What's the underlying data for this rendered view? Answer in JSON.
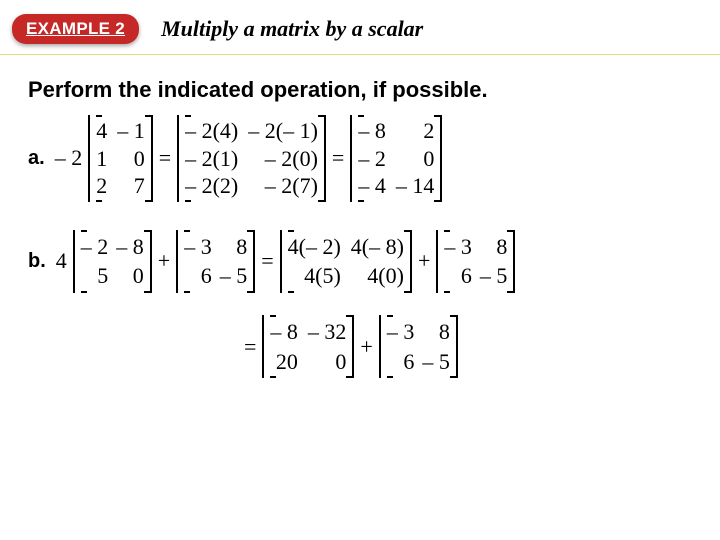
{
  "header": {
    "badge": "EXAMPLE 2",
    "title": "Multiply a matrix by a scalar"
  },
  "instruction": "Perform the indicated operation, if possible.",
  "partA": {
    "label": "a.",
    "scalar": "– 2",
    "m1": {
      "c1": [
        "4",
        "1",
        "2"
      ],
      "c2": [
        "– 1",
        "0",
        "7"
      ]
    },
    "eq1": "=",
    "m2": {
      "c1": [
        "– 2(4)",
        "– 2(1)",
        "– 2(2)"
      ],
      "c2": [
        "– 2(– 1)",
        "– 2(0)",
        "– 2(7)"
      ]
    },
    "eq2": "=",
    "m3": {
      "c1": [
        "– 8",
        "– 2",
        "– 4"
      ],
      "c2": [
        "2",
        "0",
        "– 14"
      ]
    }
  },
  "partB": {
    "label": "b.",
    "scalar": "4",
    "m1": {
      "c1": [
        "– 2",
        "5"
      ],
      "c2": [
        "– 8",
        "0"
      ]
    },
    "plus1": "+",
    "m2": {
      "c1": [
        "– 3",
        "6"
      ],
      "c2": [
        "8",
        "– 5"
      ]
    },
    "eq1": "=",
    "m3": {
      "c1": [
        "4(– 2)",
        "4(5)"
      ],
      "c2": [
        "4(– 8)",
        "4(0)"
      ]
    },
    "plus2": "+",
    "m4": {
      "c1": [
        "– 3",
        "6"
      ],
      "c2": [
        "8",
        "– 5"
      ]
    },
    "line2": {
      "eq": "=",
      "m5": {
        "c1": [
          "– 8",
          "20"
        ],
        "c2": [
          "– 32",
          "0"
        ]
      },
      "plus": "+",
      "m6": {
        "c1": [
          "– 3",
          "6"
        ],
        "c2": [
          "8",
          "– 5"
        ]
      }
    }
  }
}
